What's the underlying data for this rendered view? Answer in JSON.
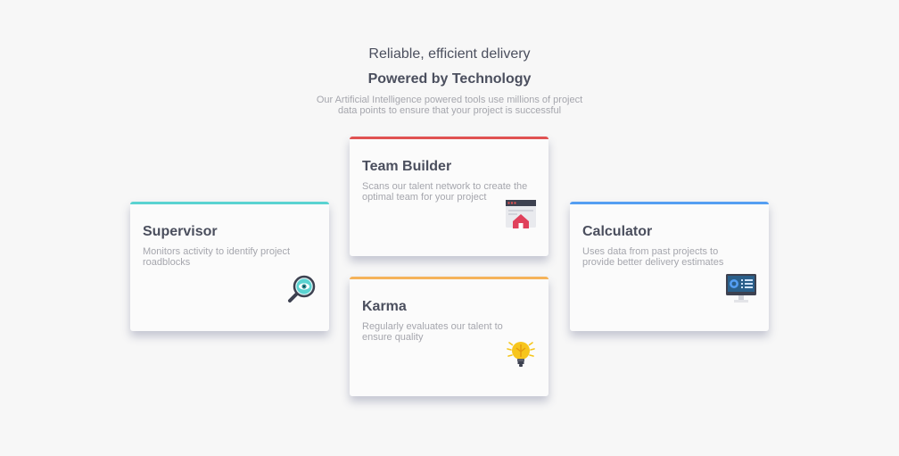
{
  "header": {
    "tagline": "Reliable, efficient delivery",
    "title": "Powered by Technology",
    "subtitle": "Our Artificial Intelligence powered tools use millions of project data points to ensure that your project is successful"
  },
  "cards": [
    {
      "title": "Supervisor",
      "description": "Monitors activity to identify project roadblocks",
      "icon": "magnifier-icon",
      "accent": "#5ad3d1"
    },
    {
      "title": "Team Builder",
      "description": "Scans our talent network to create the optimal team for your project",
      "icon": "team-builder-icon",
      "accent": "#e05252"
    },
    {
      "title": "Karma",
      "description": "Regularly evaluates our talent to ensure quality",
      "icon": "lightbulb-icon",
      "accent": "#f5b35a"
    },
    {
      "title": "Calculator",
      "description": "Uses data from past projects to provide better delivery estimates",
      "icon": "calculator-monitor-icon",
      "accent": "#549ef2"
    }
  ]
}
